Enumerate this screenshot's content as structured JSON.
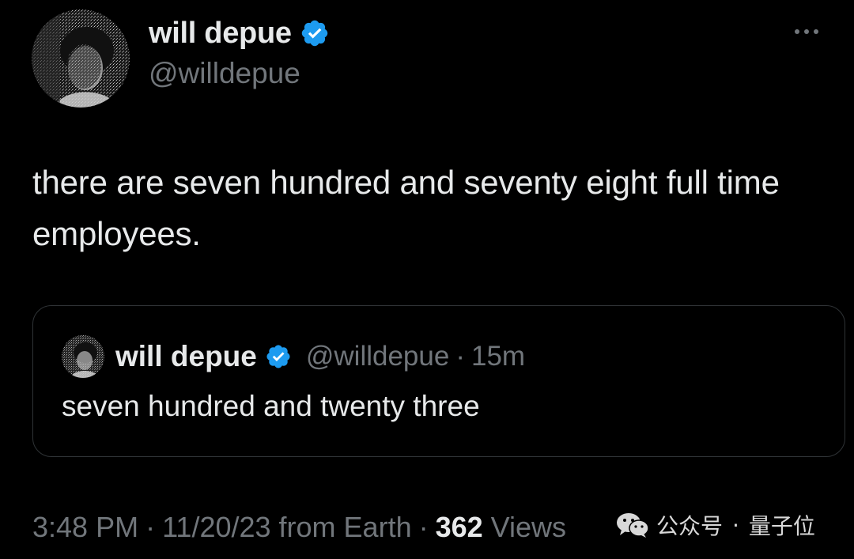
{
  "tweet": {
    "author": {
      "display_name": "will depue",
      "handle": "@willdepue",
      "verified": true
    },
    "text": "there are seven hundred and seventy eight full time employees.",
    "quoted": {
      "display_name": "will depue",
      "handle": "@willdepue",
      "separator": "·",
      "time": "15m",
      "text": "seven hundred and twenty three"
    },
    "meta": {
      "time": "3:48 PM",
      "date": "11/20/23",
      "source": "from Earth",
      "separator": "·",
      "views_count": "362",
      "views_label": "Views"
    }
  },
  "watermark": {
    "channel_type": "公众号",
    "separator": "·",
    "channel_name": "量子位"
  },
  "icons": {
    "verified": "verified-badge-icon",
    "more": "more-options-icon",
    "watermark": "wechat-icon"
  },
  "colors": {
    "background": "#000000",
    "primary_text": "#e7e9ea",
    "secondary_text": "#71767b",
    "verified_blue": "#1d9bf0",
    "border": "#2f3336"
  }
}
